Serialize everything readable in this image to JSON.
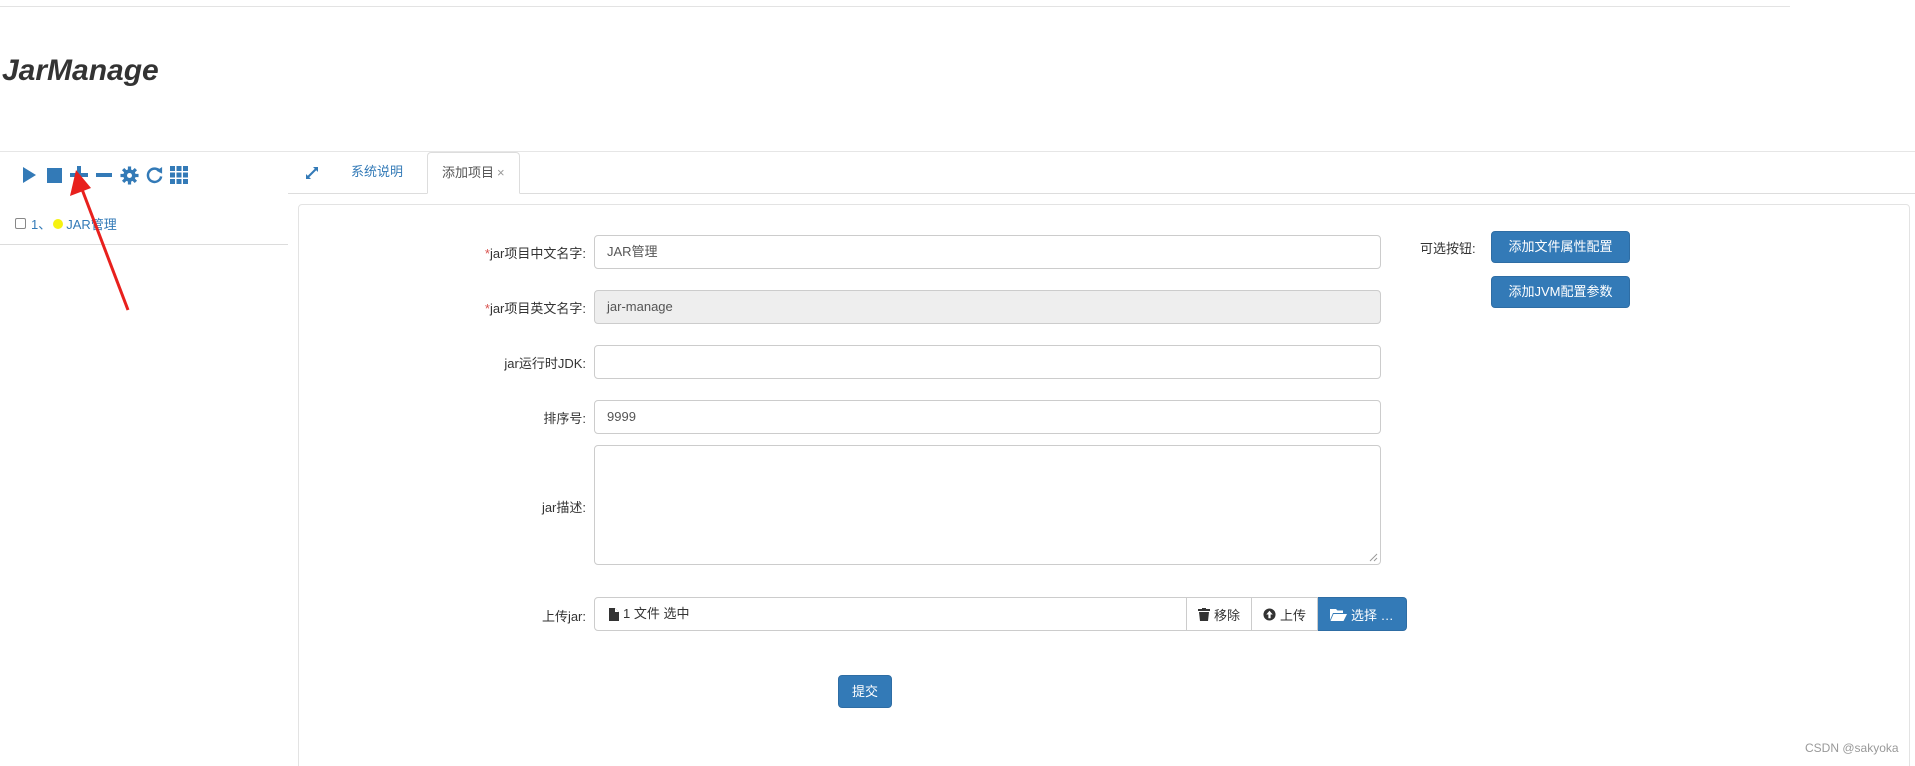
{
  "app": {
    "title": "JarManage"
  },
  "toolbar": {
    "icons": [
      "play-icon",
      "stop-icon",
      "plus-icon",
      "minus-icon",
      "gear-icon",
      "refresh-icon",
      "grid-icon"
    ]
  },
  "tree": {
    "items": [
      {
        "num": "1、",
        "label": "JAR管理",
        "status_color": "#f6f211",
        "checked": false
      }
    ]
  },
  "tabs": [
    {
      "label": "系统说明",
      "active": false
    },
    {
      "label": "添加项目",
      "active": true,
      "close": "×"
    }
  ],
  "form": {
    "cn_name": {
      "required": "*",
      "label": "jar项目中文名字:",
      "value": "JAR管理"
    },
    "en_name": {
      "required": "*",
      "label": "jar项目英文名字:",
      "value": "jar-manage"
    },
    "jdk": {
      "label": "jar运行时JDK:",
      "value": ""
    },
    "sort": {
      "label": "排序号:",
      "value": "9999"
    },
    "desc": {
      "label": "jar描述:",
      "value": ""
    },
    "upload": {
      "label": "上传jar:",
      "caption": "1 文件 选中",
      "remove": "移除",
      "upload": "上传",
      "choose": "选择 …"
    },
    "submit": "提交"
  },
  "options": {
    "label": "可选按钮:",
    "file_config": "添加文件属性配置",
    "jvm_config": "添加JVM配置参数"
  },
  "watermark": "CSDN @sakyoka",
  "colors": {
    "primary": "#337ab7",
    "required": "#d9534f",
    "annotation_arrow": "#e8201d"
  }
}
